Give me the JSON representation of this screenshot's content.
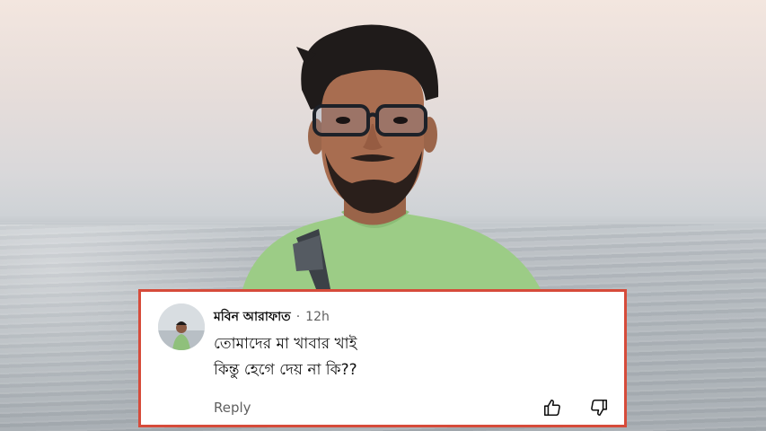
{
  "comment": {
    "username": "মবিন আরাফাত",
    "separator": "·",
    "time": "12h",
    "lines": [
      "তোমাদের মা খাবার খাই",
      "কিন্তু হেগে দেয় না কি??"
    ],
    "reply_label": "Reply",
    "like_icon": "thumbs-up-icon",
    "dislike_icon": "thumbs-down-icon"
  },
  "colors": {
    "card_border": "#d64b3a",
    "shirt": "#9ccc86",
    "sky_top": "#f3e6df",
    "sea": "#b1b7bc"
  }
}
